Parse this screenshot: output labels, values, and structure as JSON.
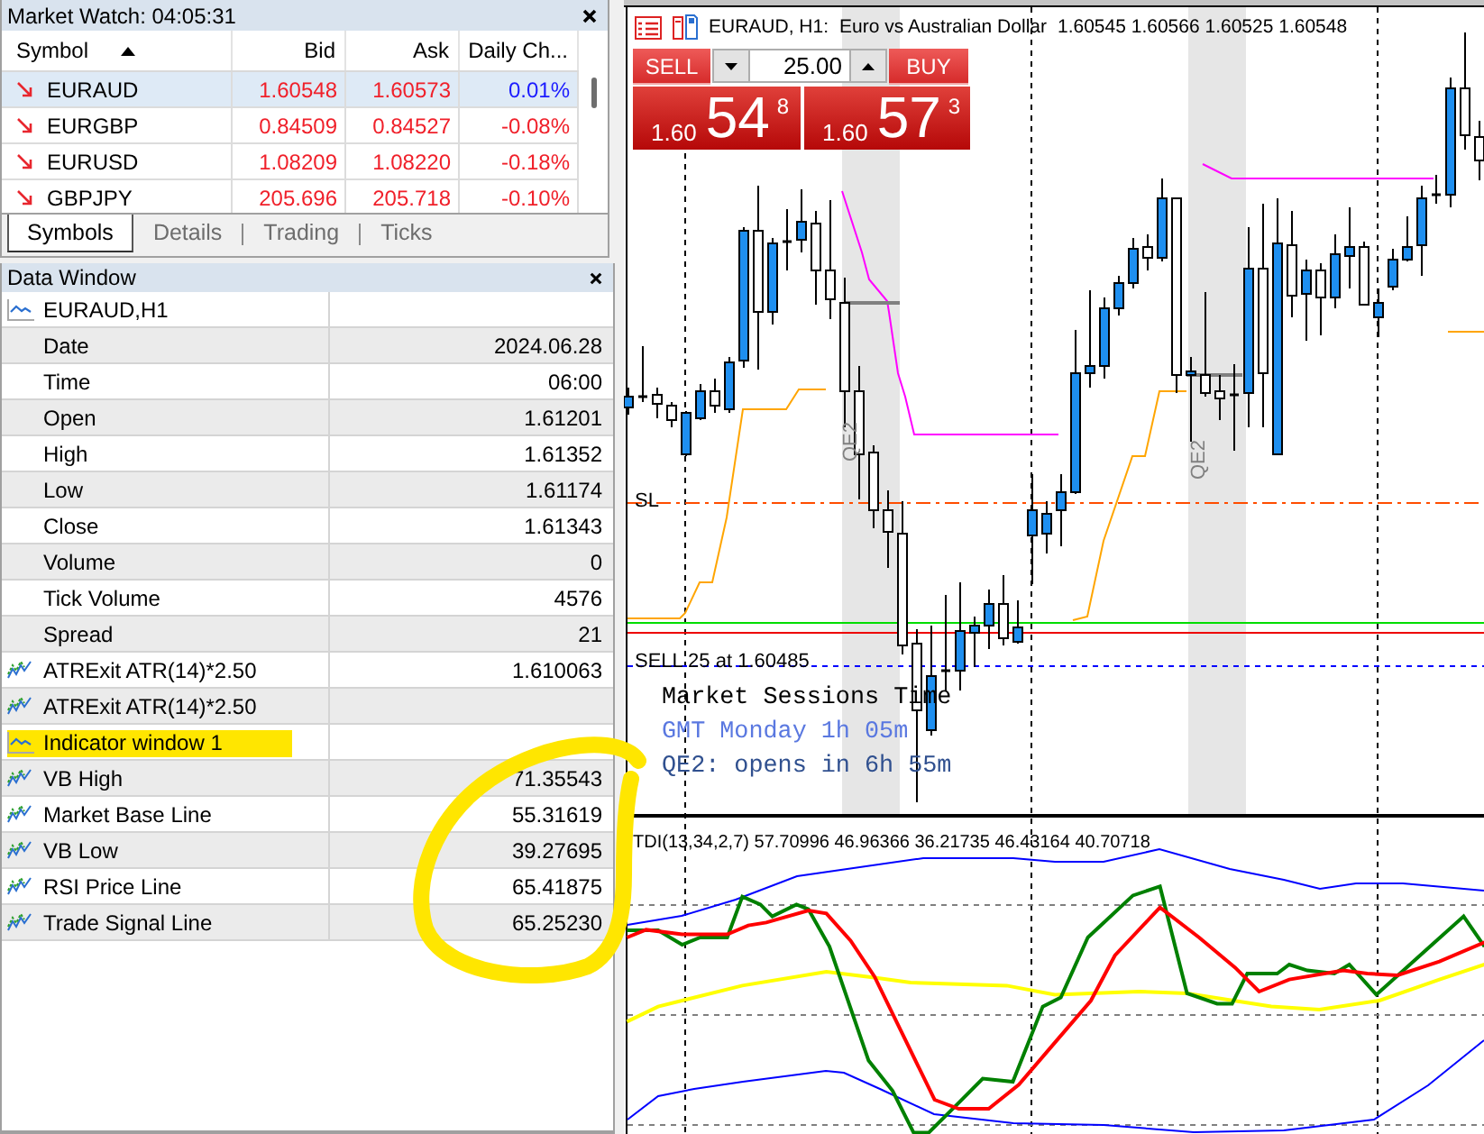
{
  "market_watch": {
    "title": "Market Watch: 04:05:31",
    "columns": [
      {
        "label": "Symbol",
        "sorted": true
      },
      {
        "label": "Bid",
        "sorted": false
      },
      {
        "label": "Ask",
        "sorted": false
      },
      {
        "label": "Daily Ch...",
        "sorted": false
      }
    ],
    "rows": [
      {
        "symbol": "EURAUD",
        "bid": "1.60548",
        "ask": "1.60573",
        "change": "0.01%",
        "rising": false,
        "change_positive": true,
        "selected": true
      },
      {
        "symbol": "EURGBP",
        "bid": "0.84509",
        "ask": "0.84527",
        "change": "-0.08%",
        "rising": false,
        "change_positive": false,
        "selected": false
      },
      {
        "symbol": "EURUSD",
        "bid": "1.08209",
        "ask": "1.08220",
        "change": "-0.18%",
        "rising": false,
        "change_positive": false,
        "selected": false
      },
      {
        "symbol": "GBPJPY",
        "bid": "205.696",
        "ask": "205.718",
        "change": "-0.10%",
        "rising": false,
        "change_positive": false,
        "selected": false
      }
    ],
    "tabs": [
      {
        "label": "Symbols",
        "selected": true
      },
      {
        "label": "Details",
        "selected": false
      },
      {
        "label": "Trading",
        "selected": false
      },
      {
        "label": "Ticks",
        "selected": false
      }
    ]
  },
  "data_window": {
    "title": "Data Window",
    "rows": [
      {
        "kind": "window",
        "label": "EURAUD,H1",
        "highlighted": false
      },
      {
        "kind": "field",
        "label": "Date",
        "value": "2024.06.28",
        "highlighted": false
      },
      {
        "kind": "field",
        "label": "Time",
        "value": "06:00",
        "highlighted": false
      },
      {
        "kind": "field",
        "label": "Open",
        "value": "1.61201",
        "highlighted": false
      },
      {
        "kind": "field",
        "label": "High",
        "value": "1.61352",
        "highlighted": false
      },
      {
        "kind": "field",
        "label": "Low",
        "value": "1.61174",
        "highlighted": false
      },
      {
        "kind": "field",
        "label": "Close",
        "value": "1.61343",
        "highlighted": false
      },
      {
        "kind": "field",
        "label": "Volume",
        "value": "0",
        "highlighted": false
      },
      {
        "kind": "field",
        "label": "Tick Volume",
        "value": "4576",
        "highlighted": false
      },
      {
        "kind": "field",
        "label": "Spread",
        "value": "21",
        "highlighted": false
      },
      {
        "kind": "indicator",
        "label": "ATRExit ATR(14)*2.50",
        "value": "1.610063",
        "highlighted": false
      },
      {
        "kind": "indicator",
        "label": "ATRExit ATR(14)*2.50",
        "highlighted": false
      },
      {
        "kind": "window",
        "label": "Indicator window 1",
        "highlighted": true
      },
      {
        "kind": "indicator",
        "label": "VB High",
        "value": "71.35543",
        "highlighted": false
      },
      {
        "kind": "indicator",
        "label": "Market Base Line",
        "value": "55.31619",
        "highlighted": false
      },
      {
        "kind": "indicator",
        "label": "VB Low",
        "value": "39.27695",
        "highlighted": false
      },
      {
        "kind": "indicator",
        "label": "RSI Price Line",
        "value": "65.41875",
        "highlighted": false
      },
      {
        "kind": "indicator",
        "label": "Trade Signal Line",
        "value": "65.25230",
        "highlighted": false
      }
    ]
  },
  "chart": {
    "title": "EURAUD, H1:",
    "description": "Euro vs Australian Dollar",
    "prices": "1.60545 1.60566 1.60525 1.60548",
    "trade_panel": {
      "sell": "SELL",
      "buy": "BUY",
      "volume": "25.00",
      "sell_price": {
        "prefix": "1.60",
        "pips": "54",
        "fraction": "8"
      },
      "buy_price": {
        "prefix": "1.60",
        "pips": "57",
        "fraction": "3"
      }
    },
    "sessions": [
      {
        "label": "QE2"
      },
      {
        "label": "QE2"
      }
    ],
    "lines": [
      {
        "kind": "stop_loss",
        "label": "SL"
      },
      {
        "kind": "order",
        "label": "SELL 25 at 1.60485"
      }
    ],
    "sessions_panel": {
      "title": "Market Sessions Time",
      "lines": [
        {
          "text": "GMT Monday 1h 05m",
          "color": "#5a78e0"
        },
        {
          "text": "QE2: opens in 6h 55m",
          "color": "#30508f"
        }
      ]
    },
    "indicator_label": "TDI(13,34,2,7) 57.70996 46.96366 36.21735 46.43164 40.70718"
  }
}
